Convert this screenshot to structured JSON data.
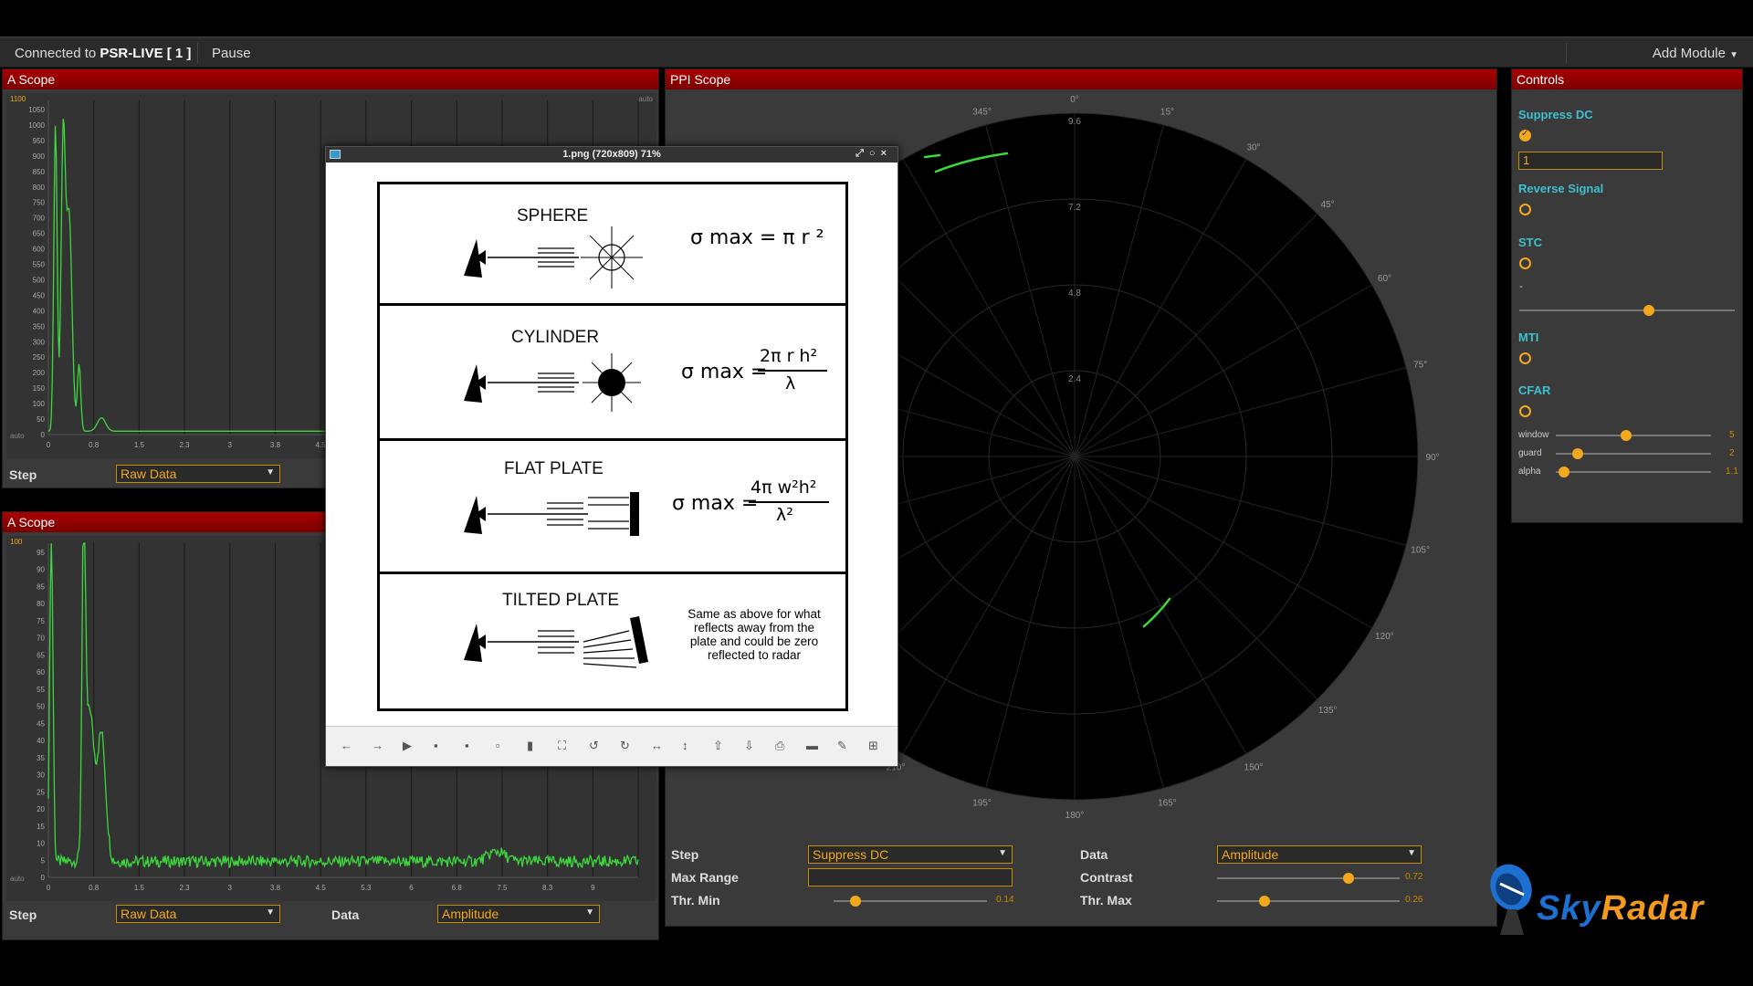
{
  "topbar": {
    "connected_prefix": "Connected to",
    "connected_name": "PSR-LIVE [ 1 ]",
    "pause_label": "Pause",
    "add_module_label": "Add Module"
  },
  "ascope1": {
    "title": "A Scope",
    "y_ticks": [
      "1050",
      "1000",
      "950",
      "900",
      "850",
      "800",
      "750",
      "700",
      "650",
      "600",
      "550",
      "500",
      "450",
      "400",
      "350",
      "300",
      "250",
      "200",
      "150",
      "100",
      "50",
      "0"
    ],
    "y_max_label": "1100",
    "x_ticks": [
      "0",
      "0.8",
      "1.5",
      "2.3",
      "3",
      "3.8",
      "4.5"
    ],
    "auto_label": "auto",
    "step_label": "Step",
    "step_value": "Raw Data"
  },
  "ascope2": {
    "title": "A Scope",
    "y_ticks": [
      "95",
      "90",
      "85",
      "80",
      "75",
      "70",
      "65",
      "60",
      "55",
      "50",
      "45",
      "40",
      "35",
      "30",
      "25",
      "20",
      "15",
      "10",
      "5",
      "0"
    ],
    "y_max_label": "100",
    "x_ticks": [
      "0",
      "0.8",
      "1.5",
      "2.3",
      "3",
      "3.8",
      "4.5",
      "5.3",
      "6",
      "6.8",
      "7.5",
      "8.3",
      "9"
    ],
    "auto_label": "auto",
    "step_label": "Step",
    "step_value": "Raw Data",
    "data_label": "Data",
    "data_value": "Amplitude"
  },
  "ppi": {
    "title": "PPI Scope",
    "angle_labels": [
      "0°",
      "15°",
      "30°",
      "45°",
      "60°",
      "75°",
      "90°",
      "105°",
      "120°",
      "135°",
      "150°",
      "165°",
      "180°",
      "195°",
      "210°",
      "345°"
    ],
    "range_labels": [
      "9.6",
      "7.2",
      "4.8",
      "2.4"
    ],
    "step_label": "Step",
    "step_value": "Suppress DC",
    "max_range_label": "Max Range",
    "max_range_value": "",
    "thr_min_label": "Thr. Min",
    "thr_min_value": "0.14",
    "thr_min_level": 0.14,
    "data_label": "Data",
    "data_value": "Amplitude",
    "contrast_label": "Contrast",
    "contrast_value": "0.72",
    "contrast_level": 0.72,
    "thr_max_label": "Thr. Max",
    "thr_max_value": "0.26",
    "thr_max_level": 0.26
  },
  "controls": {
    "title": "Controls",
    "suppress_dc_label": "Suppress DC",
    "suppress_dc_on": true,
    "suppress_dc_input": "1",
    "reverse_signal_label": "Reverse Signal",
    "stc_label": "STC",
    "stc_dash": "-",
    "stc_level": 0.6,
    "mti_label": "MTI",
    "cfar_label": "CFAR",
    "window_label": "window",
    "window_value": "5",
    "window_level": 0.45,
    "guard_label": "guard",
    "guard_value": "2",
    "guard_level": 0.14,
    "alpha_label": "alpha",
    "alpha_value": "1.1",
    "alpha_level": 0.05
  },
  "viewer": {
    "title": "1.png (720x809) 71%",
    "sphere_name": "SPHERE",
    "sphere_eq": "σ max = π r ²",
    "cylinder_name": "CYLINDER",
    "cylinder_eq_lhs": "σ max =",
    "cylinder_eq_num": "2π r h²",
    "cylinder_eq_den": "λ",
    "flat_name": "FLAT PLATE",
    "flat_eq_lhs": "σ max =",
    "flat_eq_num": "4π w²h²",
    "flat_eq_den": "λ²",
    "tilted_name": "TILTED PLATE",
    "tilted_note": "Same as above for what reflects away from the plate and could be zero reflected to radar"
  },
  "logo": {
    "part1": "Sky",
    "part2": "Radar"
  },
  "colors": {
    "accent": "#f3a81d",
    "panel_header": "#a00000",
    "signal": "#3cd83c",
    "control_title": "#3fc0d0"
  }
}
